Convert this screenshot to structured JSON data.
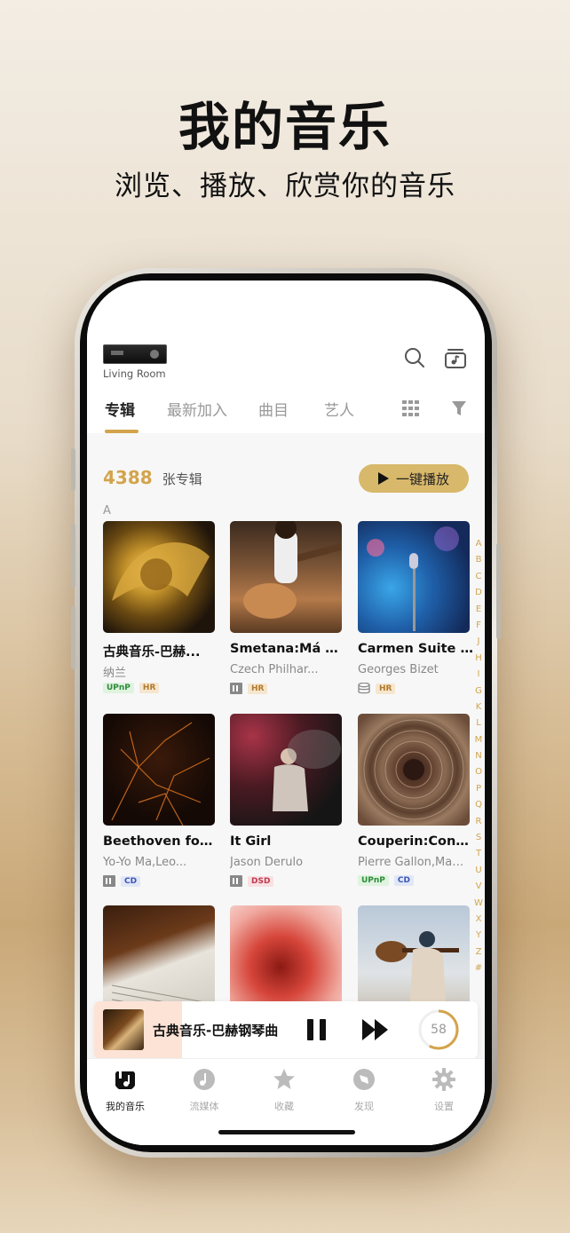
{
  "promo": {
    "title": "我的音乐",
    "subtitle": "浏览、播放、欣赏你的音乐"
  },
  "header": {
    "device_name": "Living Room",
    "icons": [
      "search-icon",
      "queue-icon"
    ]
  },
  "tabs": [
    {
      "label": "专辑",
      "active": true
    },
    {
      "label": "最新加入",
      "active": false
    },
    {
      "label": "曲目",
      "active": false
    },
    {
      "label": "艺人",
      "active": false
    }
  ],
  "tab_icons": [
    "grid-view-icon",
    "filter-icon"
  ],
  "library": {
    "count": "4388",
    "unit": "张专辑",
    "play_all_label": "一键播放",
    "section_letter": "A"
  },
  "albums": [
    {
      "title": "古典音乐-巴赫...",
      "artist": "纳兰",
      "badges": [
        "UPnP",
        "HR"
      ],
      "source_icon": ""
    },
    {
      "title": "Smetana:Má Vla",
      "artist": "Czech Philhar...",
      "badges": [
        "HR"
      ],
      "source_icon": "storage-icon"
    },
    {
      "title": "Carmen Suite N..",
      "artist": "Georges Bizet",
      "badges": [
        "HR"
      ],
      "source_icon": "database-icon"
    },
    {
      "title": "Beethoven for T...",
      "artist": "Yo-Yo Ma,Leo...",
      "badges": [
        "CD"
      ],
      "source_icon": "storage-icon"
    },
    {
      "title": "It Girl",
      "artist": "Jason Derulo",
      "badges": [
        "DSD"
      ],
      "source_icon": "storage-icon"
    },
    {
      "title": "Couperin:Conce...",
      "artist": "Pierre Gallon,Matt...",
      "badges": [
        "UPnP",
        "CD"
      ],
      "source_icon": ""
    },
    {
      "title": "",
      "artist": "",
      "badges": [],
      "source_icon": ""
    },
    {
      "title": "",
      "artist": "",
      "badges": [],
      "source_icon": ""
    },
    {
      "title": "",
      "artist": "",
      "badges": [],
      "source_icon": ""
    }
  ],
  "alphabet": [
    "A",
    "B",
    "C",
    "D",
    "E",
    "F",
    "J",
    "H",
    "I",
    "G",
    "K",
    "L",
    "M",
    "N",
    "O",
    "P",
    "Q",
    "R",
    "S",
    "T",
    "U",
    "V",
    "W",
    "X",
    "Y",
    "Z",
    "#"
  ],
  "now_playing": {
    "title": "古典音乐-巴赫钢琴曲",
    "progress_fraction": 0.23,
    "ring_value": "58",
    "ring_fraction": 0.58
  },
  "bottom_nav": [
    {
      "label": "我的音乐",
      "icon": "my-music-icon",
      "active": true
    },
    {
      "label": "流媒体",
      "icon": "streaming-icon",
      "active": false
    },
    {
      "label": "收藏",
      "icon": "star-icon",
      "active": false
    },
    {
      "label": "发现",
      "icon": "discover-icon",
      "active": false
    },
    {
      "label": "设置",
      "icon": "gear-icon",
      "active": false
    }
  ],
  "colors": {
    "accent": "#d3a44c",
    "play_all_bg": "#d8b86a"
  }
}
